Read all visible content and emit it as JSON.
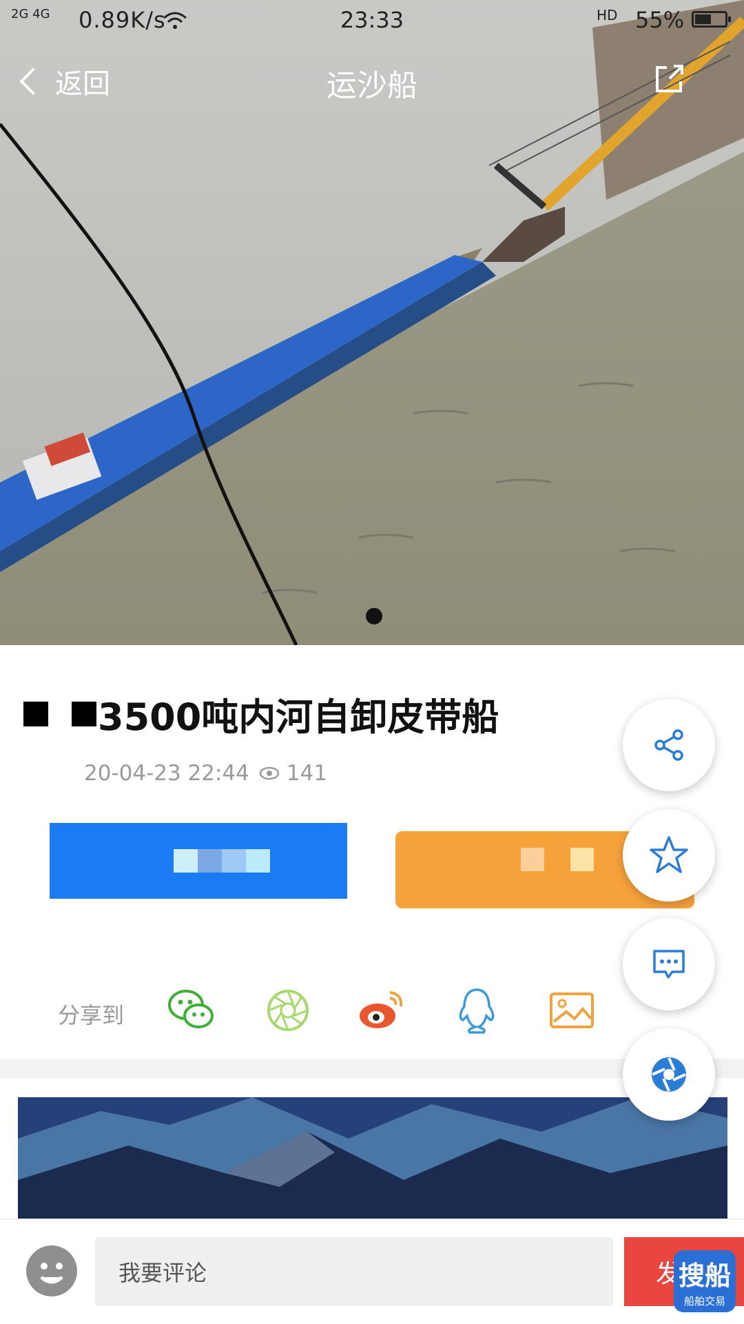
{
  "status_bar": {
    "signal": "2G 4G",
    "net_speed": "0.89K/s",
    "time": "23:33",
    "hd": "HD",
    "battery_pct": "55%",
    "battery_level": 0.55
  },
  "nav": {
    "back_label": "返回",
    "title": "运沙船"
  },
  "gallery": {
    "current_index": 1,
    "total": 1
  },
  "post": {
    "title": "3500吨内河自卸皮带船",
    "date": "20-04-23 22:44",
    "views": "141"
  },
  "share": {
    "label": "分享到",
    "targets": [
      "wechat-icon",
      "moments-icon",
      "weibo-icon",
      "qq-icon",
      "image-icon"
    ]
  },
  "colors": {
    "blue": "#1b7bf2",
    "orange": "#f6a23a",
    "red": "#e8463e",
    "icon_blue": "#2a7dd6"
  },
  "fab": [
    "share-icon",
    "star-icon",
    "comment-icon",
    "shutter-icon"
  ],
  "comment": {
    "placeholder": "我要评论",
    "send_label": "发"
  },
  "logo": {
    "text": "搜船",
    "sub": "船舶交易"
  }
}
